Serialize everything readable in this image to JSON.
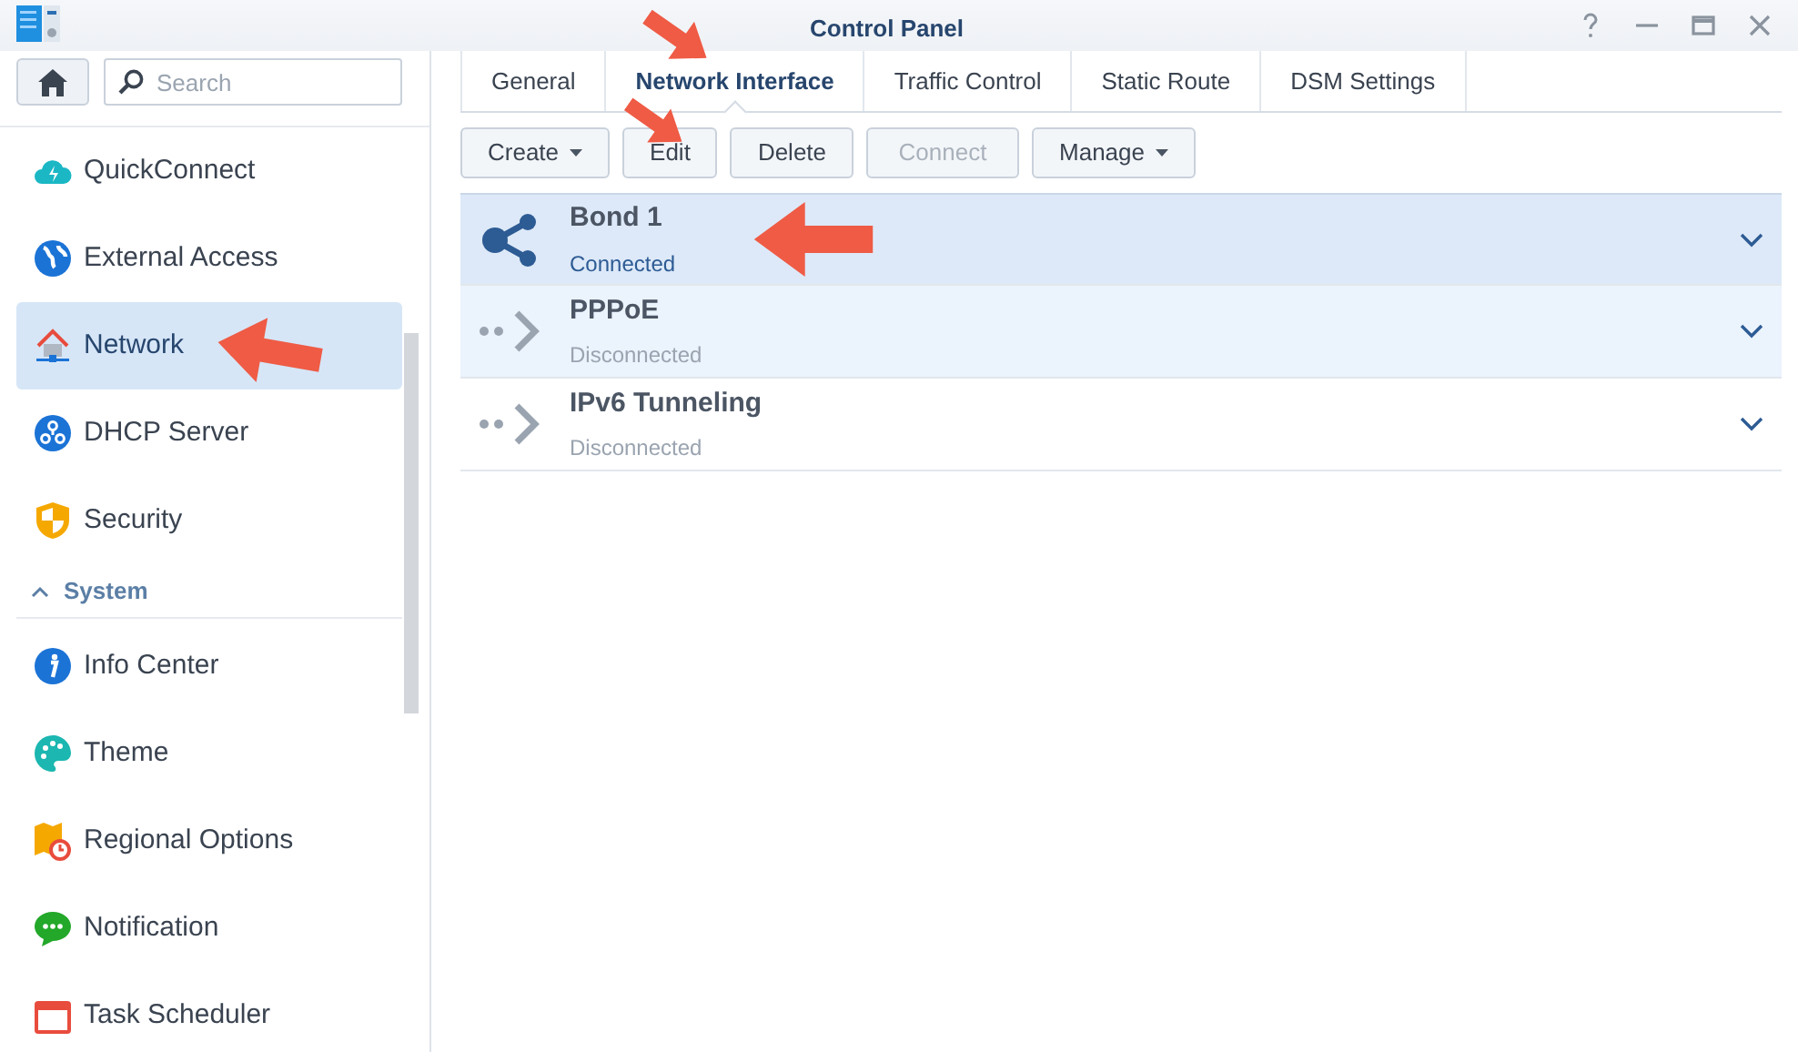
{
  "window": {
    "title": "Control Panel"
  },
  "sidebar": {
    "search": {
      "placeholder": "Search"
    },
    "items": [
      {
        "kind": "item",
        "label": "QuickConnect",
        "selected": false
      },
      {
        "kind": "item",
        "label": "External Access",
        "selected": false
      },
      {
        "kind": "item",
        "label": "Network",
        "selected": true
      },
      {
        "kind": "item",
        "label": "DHCP Server",
        "selected": false
      },
      {
        "kind": "item",
        "label": "Security",
        "selected": false
      },
      {
        "kind": "section",
        "label": "System",
        "expanded": true
      },
      {
        "kind": "item",
        "label": "Info Center",
        "selected": false
      },
      {
        "kind": "item",
        "label": "Theme",
        "selected": false
      },
      {
        "kind": "item",
        "label": "Regional Options",
        "selected": false
      },
      {
        "kind": "item",
        "label": "Notification",
        "selected": false
      },
      {
        "kind": "item",
        "label": "Task Scheduler",
        "selected": false
      }
    ]
  },
  "tabs": [
    {
      "label": "General",
      "selected": false
    },
    {
      "label": "Network Interface",
      "selected": true
    },
    {
      "label": "Traffic Control",
      "selected": false
    },
    {
      "label": "Static Route",
      "selected": false
    },
    {
      "label": "DSM Settings",
      "selected": false
    }
  ],
  "toolbar": [
    {
      "label": "Create",
      "dropdown": true,
      "disabled": false
    },
    {
      "label": "Edit",
      "dropdown": false,
      "disabled": false
    },
    {
      "label": "Delete",
      "dropdown": false,
      "disabled": false
    },
    {
      "label": "Connect",
      "dropdown": false,
      "disabled": true
    },
    {
      "label": "Manage",
      "dropdown": true,
      "disabled": false
    }
  ],
  "interfaces": [
    {
      "kind": "bond",
      "name": "Bond 1",
      "status": "Connected",
      "connected": true,
      "selected": true,
      "hovered": false
    },
    {
      "kind": "pppoe",
      "name": "PPPoE",
      "status": "Disconnected",
      "connected": false,
      "selected": false,
      "hovered": true
    },
    {
      "kind": "tunnel",
      "name": "IPv6 Tunneling",
      "status": "Disconnected",
      "connected": false,
      "selected": false,
      "hovered": false
    }
  ]
}
